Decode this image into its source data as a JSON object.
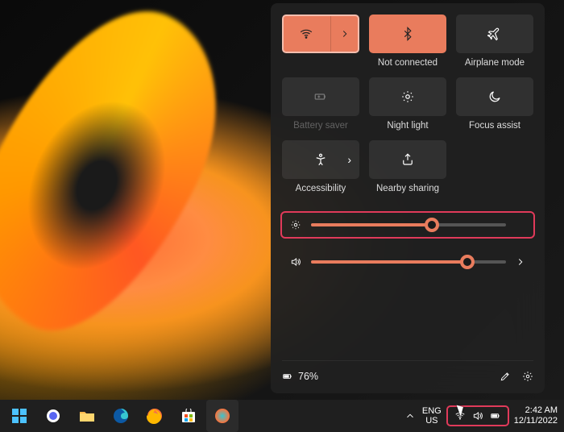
{
  "tiles": {
    "wifi": {
      "label": "",
      "active": true,
      "split": true
    },
    "bluetooth": {
      "label": "Not connected",
      "active": true
    },
    "airplane": {
      "label": "Airplane mode"
    },
    "battery": {
      "label": "Battery saver",
      "disabled": true
    },
    "night": {
      "label": "Night light"
    },
    "focus": {
      "label": "Focus assist"
    },
    "access": {
      "label": "Accessibility",
      "chev": true
    },
    "nearby": {
      "label": "Nearby sharing"
    }
  },
  "sliders": {
    "brightness": {
      "percent": 62,
      "highlight": true
    },
    "volume": {
      "percent": 80,
      "expand": true
    }
  },
  "footer": {
    "battery_text": "76%"
  },
  "taskbar": {
    "lang_top": "ENG",
    "lang_bot": "US",
    "time": "2:42 AM",
    "date": "12/11/2022"
  }
}
